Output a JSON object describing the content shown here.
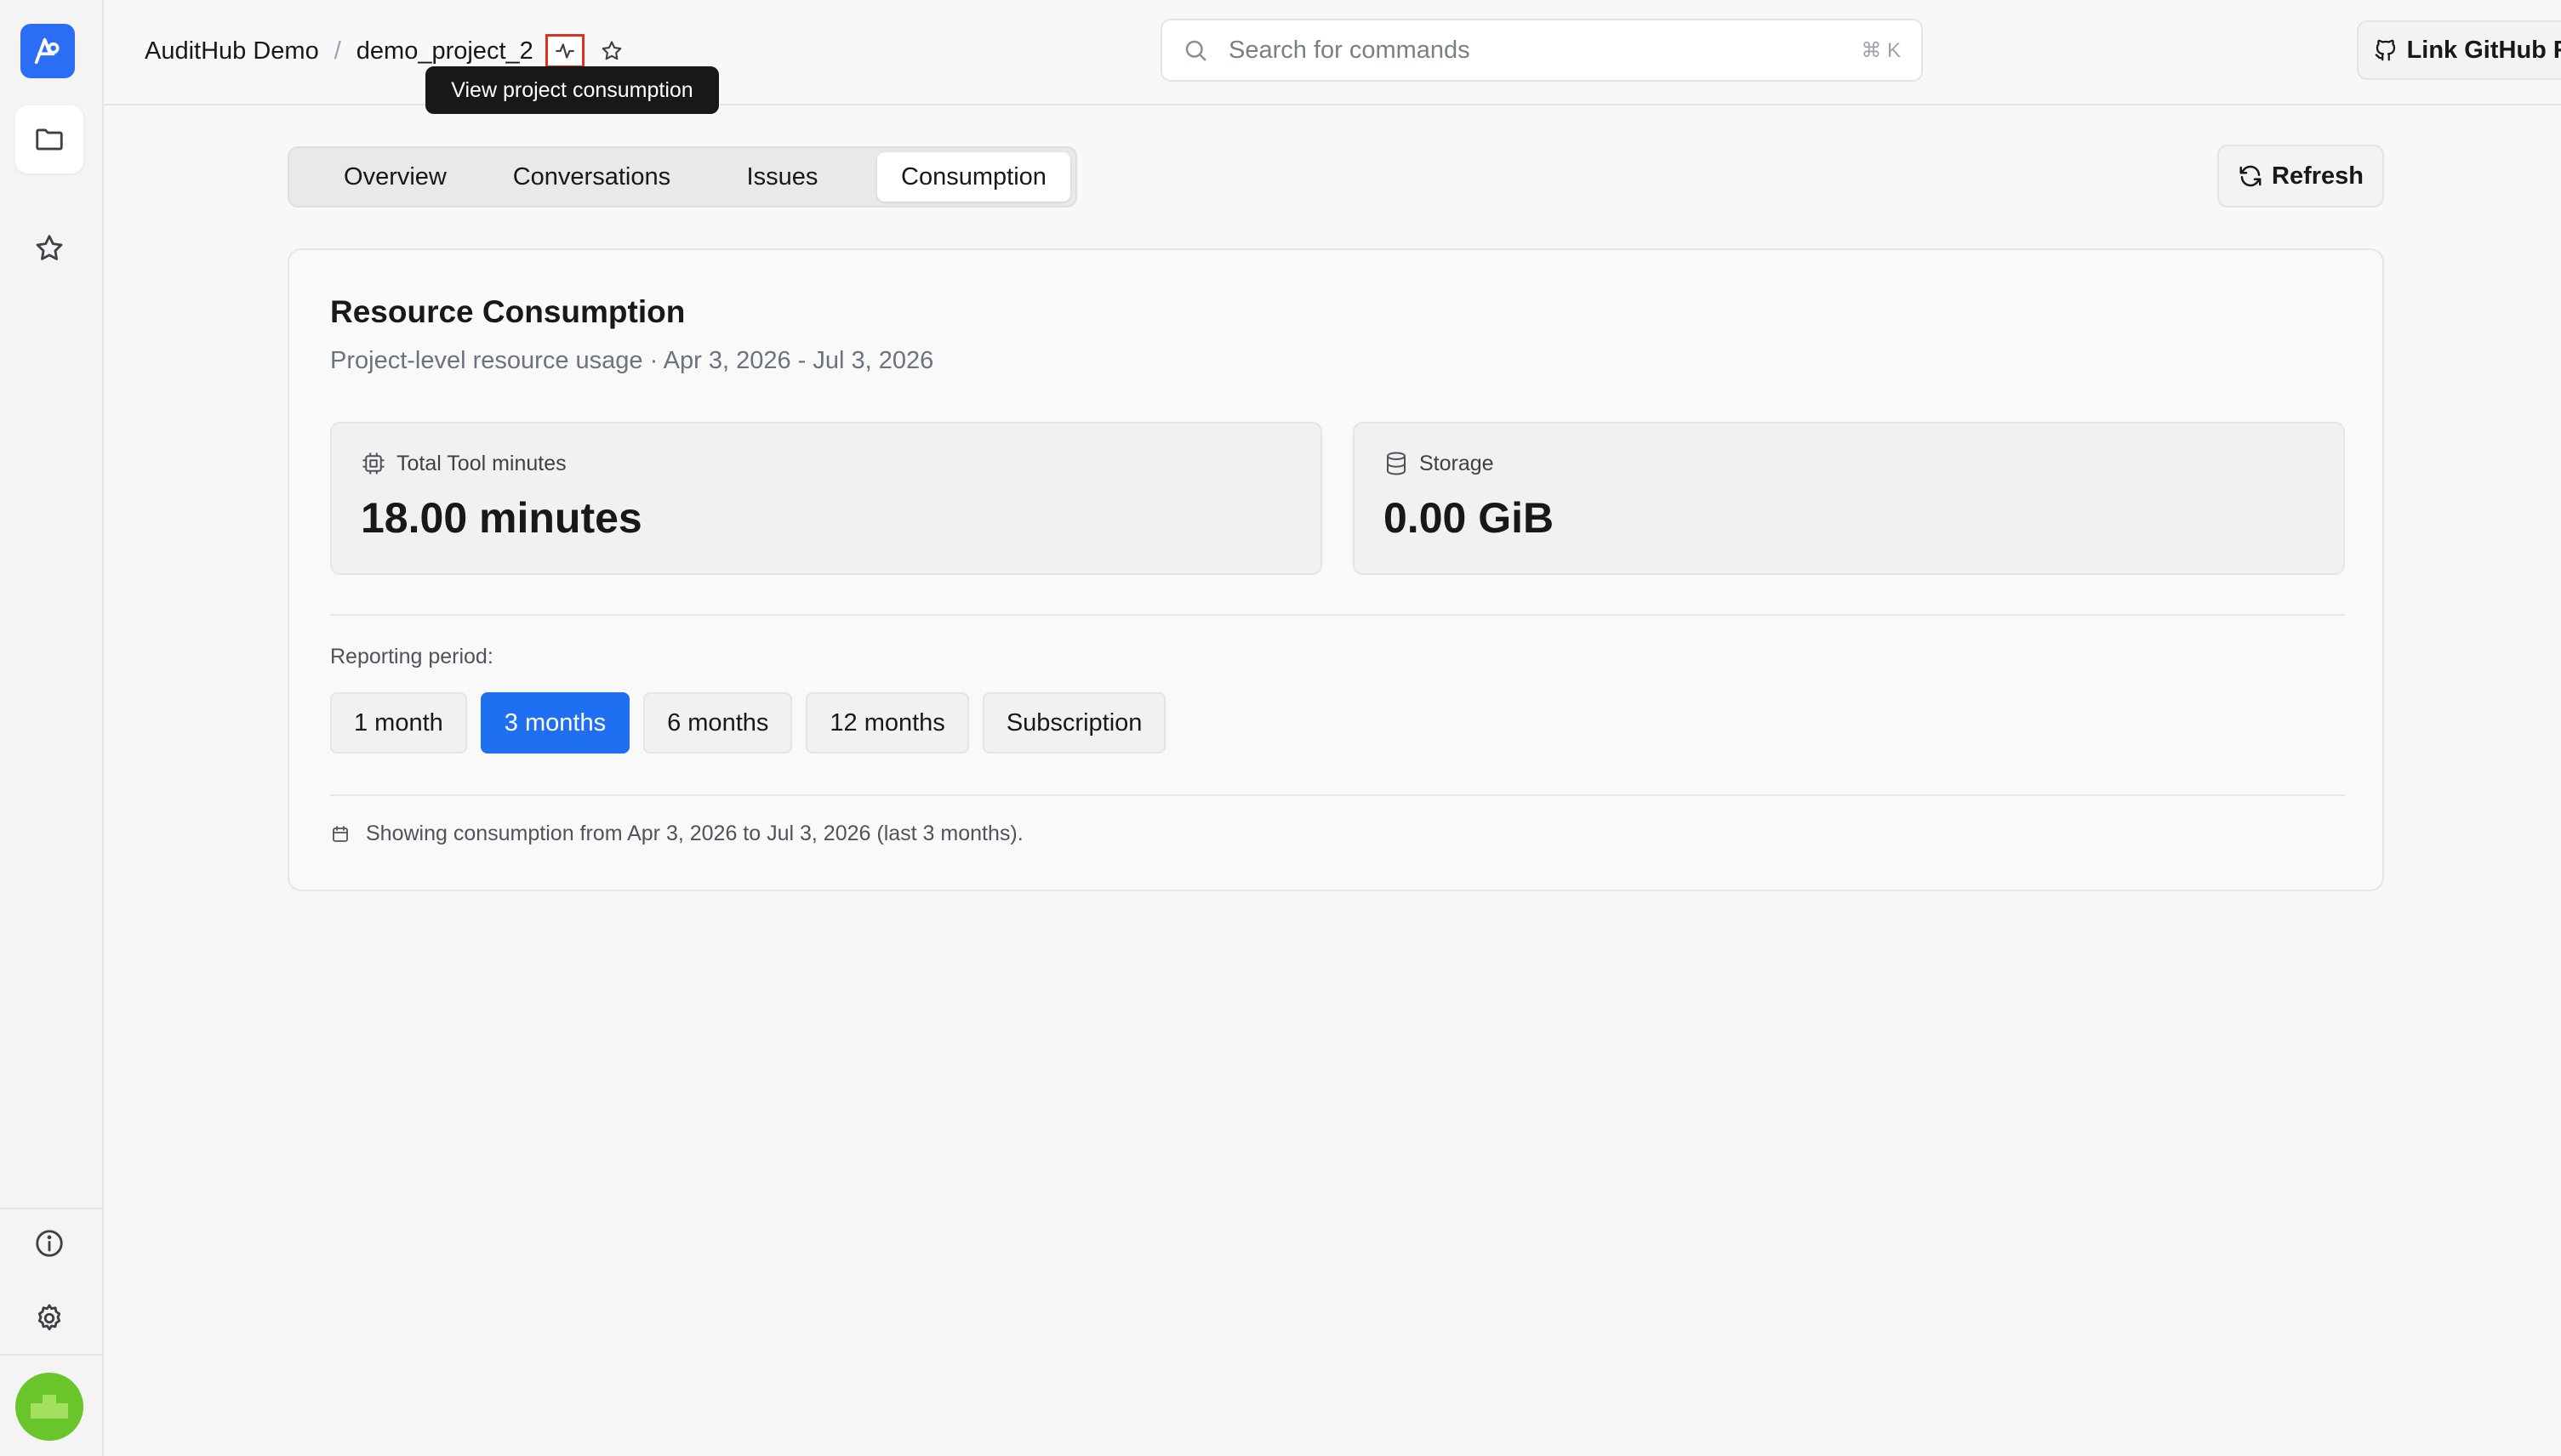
{
  "breadcrumb": {
    "org": "AuditHub Demo",
    "separator": "/",
    "project": "demo_project_2"
  },
  "tooltip": "View project consumption",
  "search": {
    "placeholder": "Search for commands",
    "shortcut": "⌘ K"
  },
  "header": {
    "github_button": "Link GitHub Repo"
  },
  "tabs": [
    {
      "label": "Overview",
      "active": false
    },
    {
      "label": "Conversations",
      "active": false
    },
    {
      "label": "Issues",
      "active": false
    },
    {
      "label": "Consumption",
      "active": true
    }
  ],
  "refresh_label": "Refresh",
  "consumption": {
    "title": "Resource Consumption",
    "subtitle": "Project-level resource usage · Apr 3, 2026 - Jul 3, 2026",
    "metrics": [
      {
        "label": "Total Tool minutes",
        "value": "18.00 minutes",
        "icon": "cpu-icon"
      },
      {
        "label": "Storage",
        "value": "0.00 GiB",
        "icon": "database-icon"
      }
    ],
    "period_label": "Reporting period:",
    "periods": [
      {
        "label": "1 month",
        "selected": false
      },
      {
        "label": "3 months",
        "selected": true
      },
      {
        "label": "6 months",
        "selected": false
      },
      {
        "label": "12 months",
        "selected": false
      },
      {
        "label": "Subscription",
        "selected": false
      }
    ],
    "footnote": "Showing consumption from Apr 3, 2026 to Jul 3, 2026 (last 3 months)."
  },
  "colors": {
    "accent": "#1f6ff2",
    "logo": "#2b6ef5",
    "avatar": "#6ac52a",
    "highlight_border": "#e0301e"
  }
}
